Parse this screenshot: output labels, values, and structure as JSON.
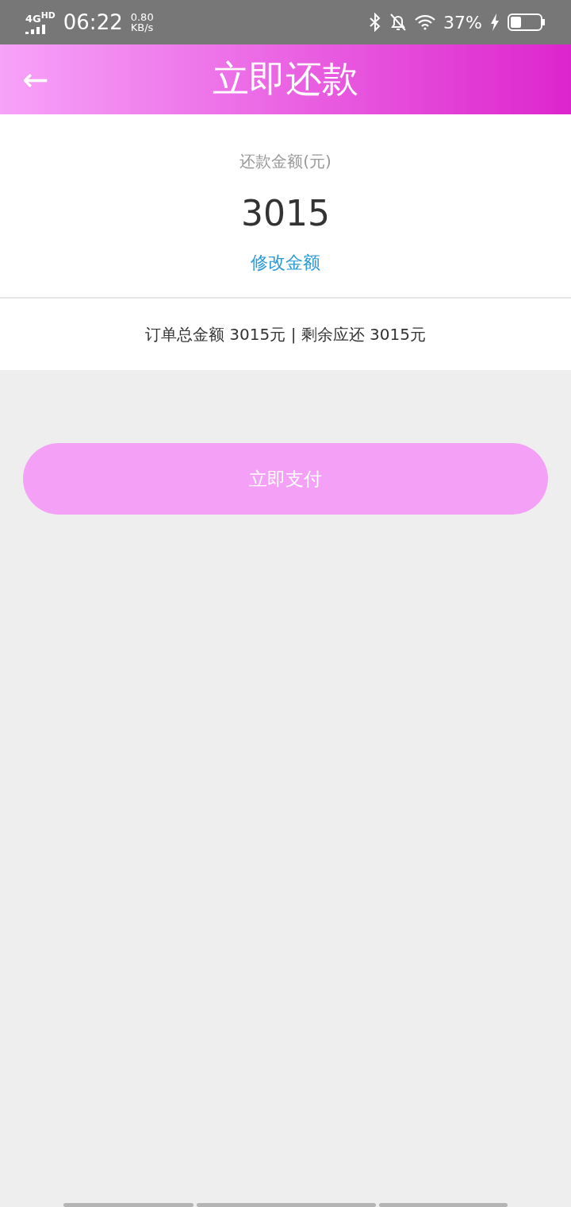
{
  "status_bar": {
    "network": "4G",
    "network_sup": "HD",
    "time": "06:22",
    "speed_value": "0.80",
    "speed_unit": "KB/s",
    "battery_text": "37%",
    "charging": true
  },
  "header": {
    "back_icon": "←",
    "title": "立即还款"
  },
  "amount_card": {
    "label": "还款金额(元)",
    "amount": "3015",
    "edit_link": "修改金额"
  },
  "summary": "订单总金额 3015元 | 剩余应还 3015元",
  "pay_button": {
    "label": "立即支付",
    "disabled": true
  }
}
